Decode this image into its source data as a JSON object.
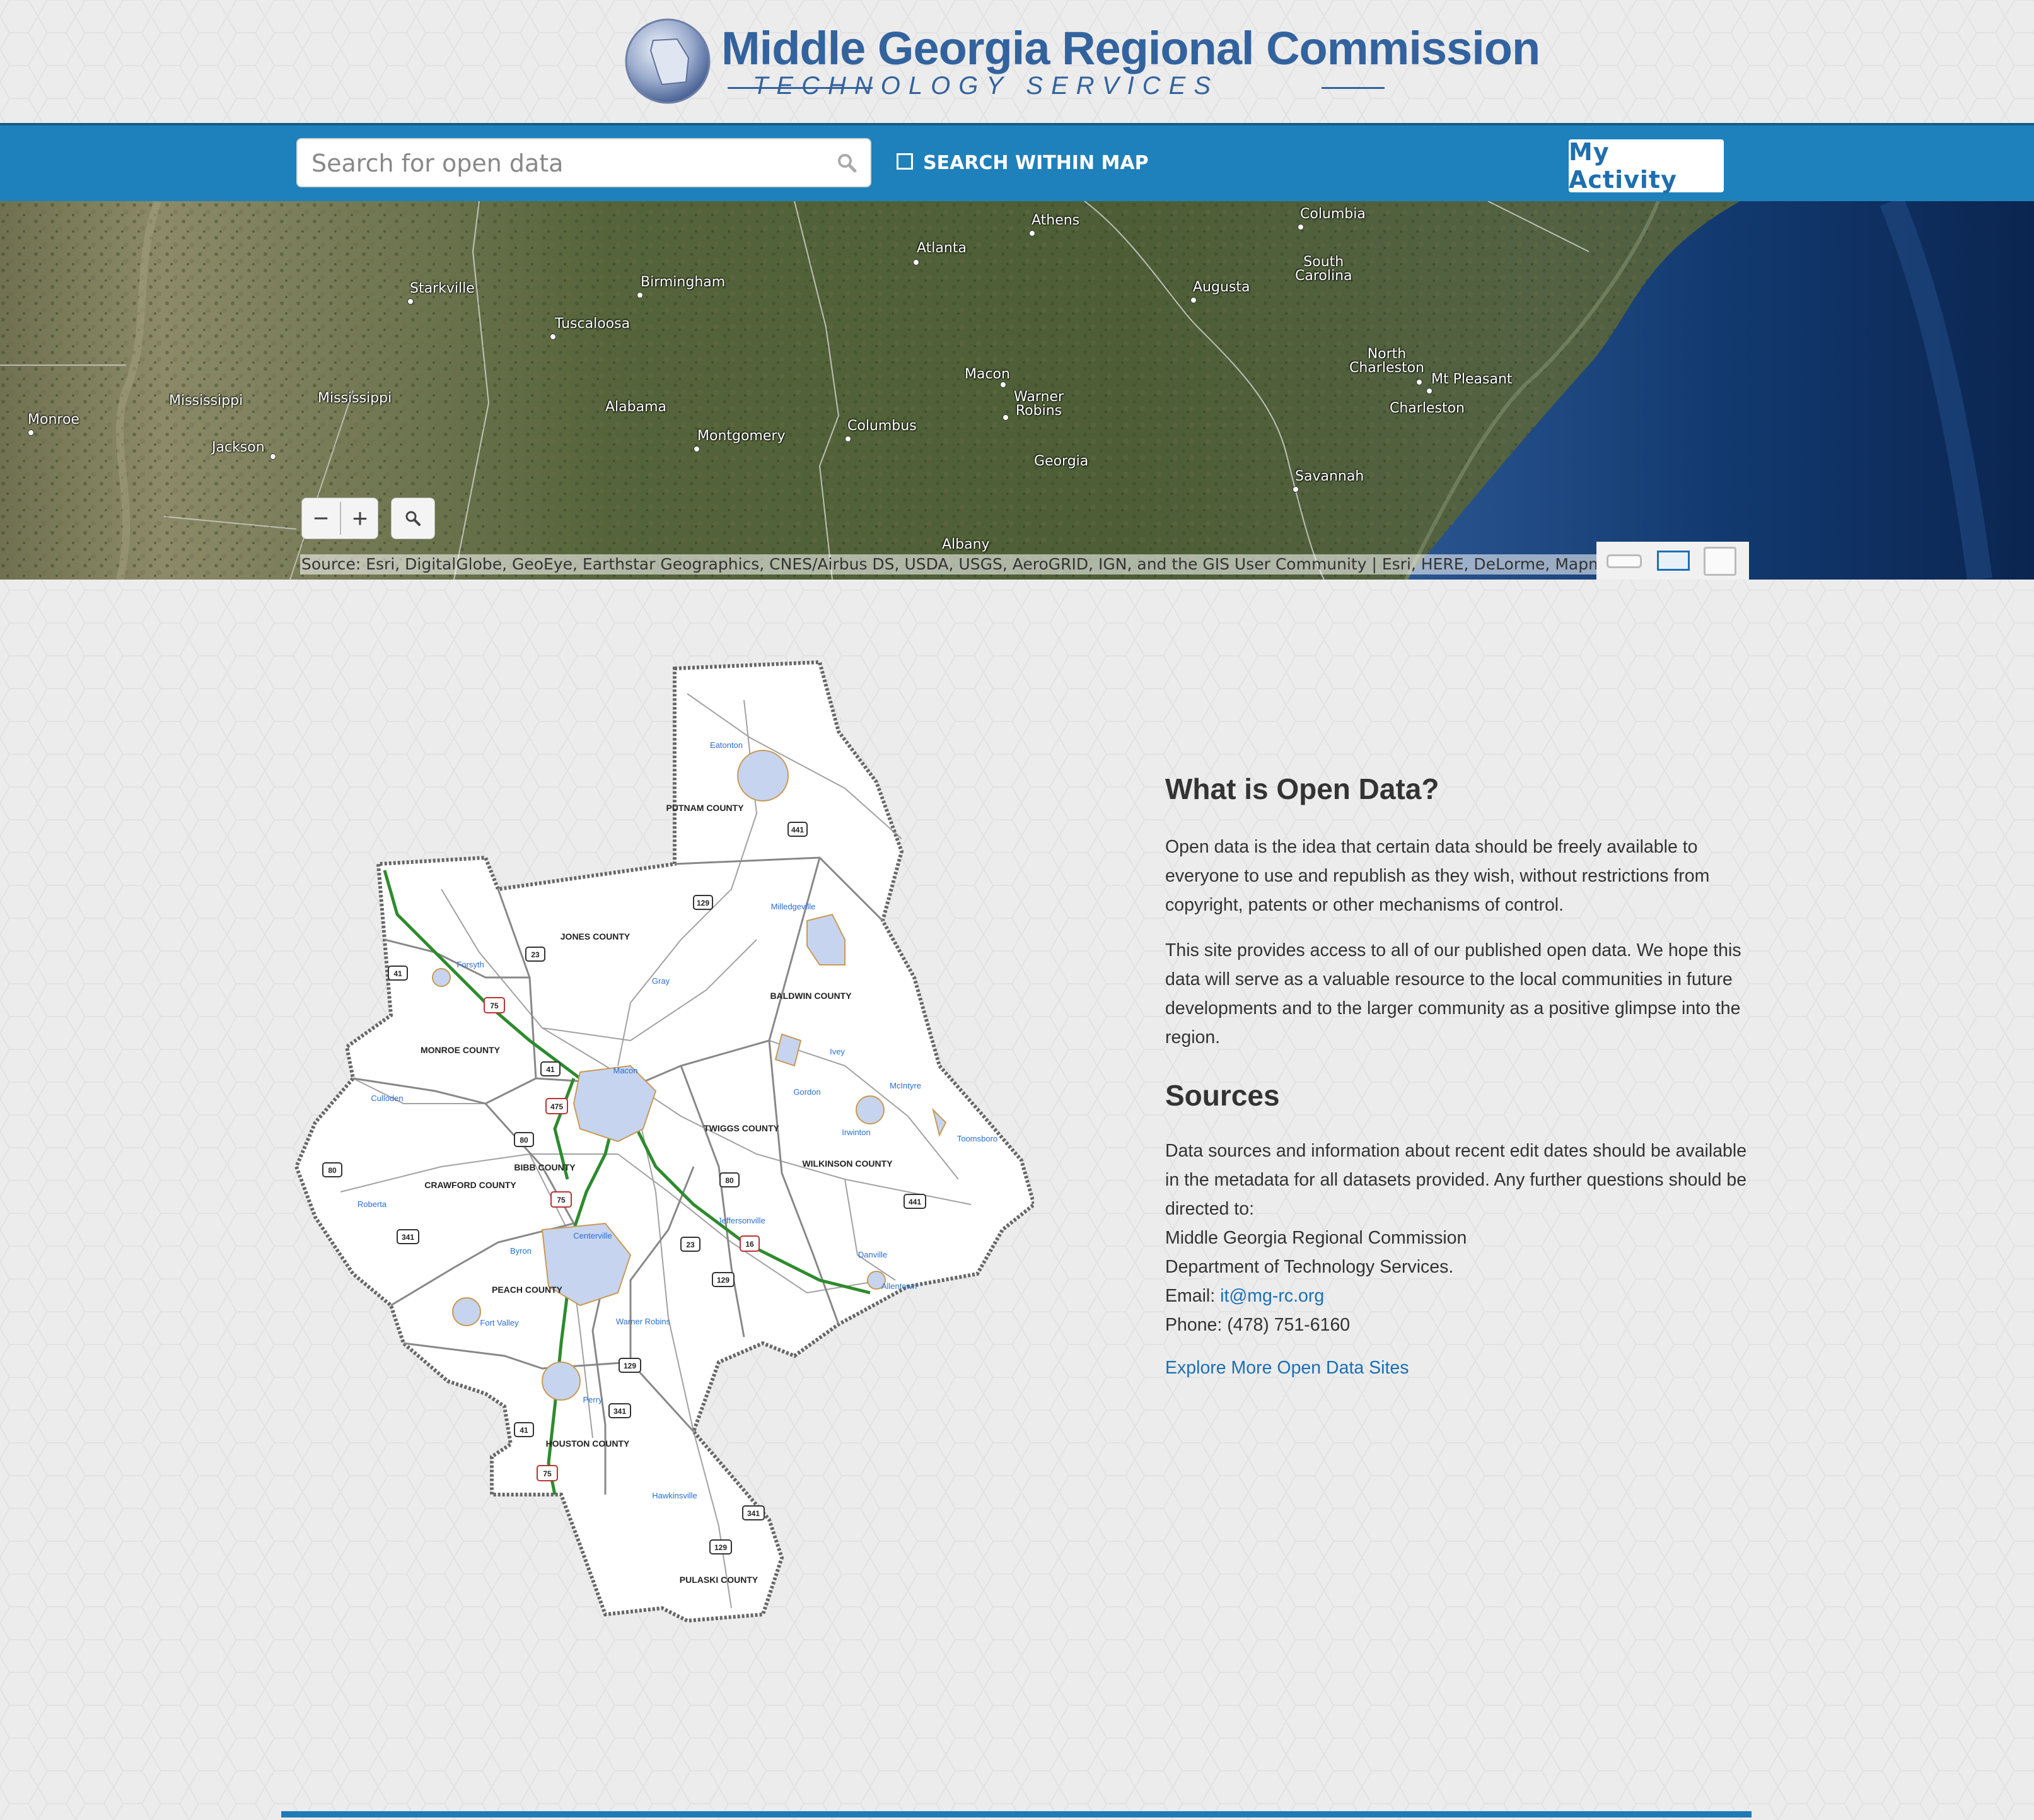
{
  "header": {
    "logo_title": "Middle Georgia Regional Commission",
    "logo_subtitle": "TECHNOLOGY SERVICES"
  },
  "navbar": {
    "search_placeholder": "Search for open data",
    "search_within_map_label": "SEARCH WITHIN MAP",
    "search_within_map_checked": false,
    "my_activity_label": "My Activity"
  },
  "satellite_map": {
    "place_labels": [
      "Athens",
      "Columbia",
      "Atlanta",
      "South Carolina",
      "Starkville",
      "Birmingham",
      "Augusta",
      "Tuscaloosa",
      "North Charleston",
      "Mt Pleasant",
      "Mississippi",
      "Mississippi",
      "Alabama",
      "Macon",
      "Warner Robins",
      "Charleston",
      "Monroe",
      "Jackson",
      "Montgomery",
      "Columbus",
      "Georgia",
      "Savannah",
      "Albany"
    ],
    "zoom_out_label": "−",
    "zoom_in_label": "+",
    "attribution": "Source: Esri, DigitalGlobe, GeoEye, Earthstar Geographics, CNES/Airbus DS, USDA, USGS, AeroGRID, IGN, and the GIS User Community | Esri, HERE, DeLorme, MapmyIndia, ©"
  },
  "region_map": {
    "county_labels": [
      "PUTNAM COUNTY",
      "JONES COUNTY",
      "BALDWIN COUNTY",
      "MONROE COUNTY",
      "TWIGGS COUNTY",
      "WILKINSON COUNTY",
      "BIBB COUNTY",
      "CRAWFORD COUNTY",
      "PEACH COUNTY",
      "HOUSTON COUNTY",
      "PULASKI COUNTY"
    ],
    "city_labels": [
      "Eatonton",
      "Milledgeville",
      "Forsyth",
      "Gray",
      "Macon",
      "Ivey",
      "Gordon",
      "McIntyre",
      "Culloden",
      "Irwinton",
      "Toomsboro",
      "Roberta",
      "Jeffersonville",
      "Byron",
      "Centerville",
      "Danville",
      "Allentown",
      "Fort Valley",
      "Warner Robins",
      "Perry",
      "Hawkinsville"
    ],
    "route_shields": [
      "441",
      "129",
      "41",
      "23",
      "75",
      "41",
      "475",
      "80",
      "80",
      "75",
      "341",
      "23",
      "129",
      "16",
      "80",
      "441",
      "129",
      "341",
      "41",
      "75",
      "341",
      "129"
    ]
  },
  "content": {
    "what_heading": "What is Open Data?",
    "what_p1": "Open data is the idea that certain data should be freely available to everyone to use and republish as they wish, without restrictions from copyright, patents or other mechanisms of control.",
    "what_p2": "This site provides access to all of our published open data. We hope this data will serve as a valuable resource to the local communities in future developments and to the larger community as a positive glimpse into the region.",
    "sources_heading": "Sources",
    "sources_p": "Data sources and information about recent edit dates should be available in the metadata for all datasets provided. Any further questions should be directed to:",
    "org_name": "Middle Georgia Regional Commission",
    "dept": "Department of Technology Services.",
    "email_label": "Email: ",
    "email": "it@mg-rc.org",
    "phone": "Phone: (478) 751-6160",
    "explore_link": "Explore More Open Data Sites"
  },
  "colors": {
    "navbar": "#1f81bb",
    "logo_blue": "#33639e",
    "link": "#1b6fb5",
    "background": "#ececec"
  }
}
